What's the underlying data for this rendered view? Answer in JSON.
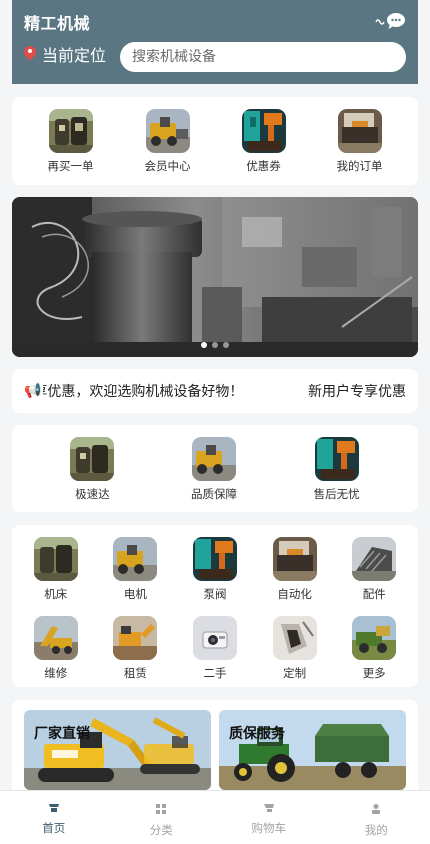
{
  "header": {
    "title": "精工机械",
    "location_label": "当前定位",
    "search_placeholder": "搜索机械设备",
    "search_value": ""
  },
  "quick_actions": [
    {
      "label": "再买一单",
      "icon": "order-again-icon"
    },
    {
      "label": "会员中心",
      "icon": "member-center-icon"
    },
    {
      "label": "优惠券",
      "icon": "coupon-icon"
    },
    {
      "label": "我的订单",
      "icon": "my-orders-icon"
    }
  ],
  "banner": {
    "slides": 3,
    "active_slide": 1
  },
  "notice": {
    "text": "享优惠，欢迎选购机械设备好物！",
    "promo": "新用户专享优惠"
  },
  "services": [
    {
      "label": "极速达"
    },
    {
      "label": "品质保障"
    },
    {
      "label": "售后无忧"
    }
  ],
  "categories": [
    {
      "label": "机床"
    },
    {
      "label": "电机"
    },
    {
      "label": "泵阀"
    },
    {
      "label": "自动化"
    },
    {
      "label": "配件"
    },
    {
      "label": "维修"
    },
    {
      "label": "租赁"
    },
    {
      "label": "二手"
    },
    {
      "label": "定制"
    },
    {
      "label": "更多"
    }
  ],
  "promos": [
    {
      "title": "厂家直销"
    },
    {
      "title": "质保服务"
    }
  ],
  "tabbar": [
    {
      "label": "首页",
      "icon": "home-icon",
      "active": true
    },
    {
      "label": "分类",
      "icon": "category-icon",
      "active": false
    },
    {
      "label": "购物车",
      "icon": "cart-icon",
      "active": false
    },
    {
      "label": "我的",
      "icon": "profile-icon",
      "active": false
    }
  ],
  "colors": {
    "header_bg": "#5a7683",
    "page_bg": "#f4f5f7",
    "tab_active": "#3f5d6e",
    "tab_inactive": "#a3a3a3"
  }
}
